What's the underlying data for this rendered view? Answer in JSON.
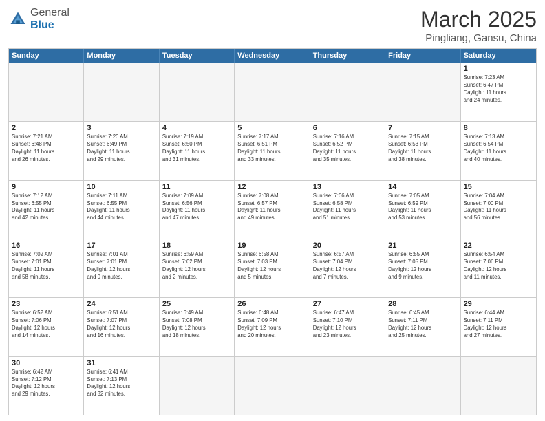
{
  "header": {
    "logo_general": "General",
    "logo_blue": "Blue",
    "month_year": "March 2025",
    "location": "Pingliang, Gansu, China"
  },
  "weekdays": [
    "Sunday",
    "Monday",
    "Tuesday",
    "Wednesday",
    "Thursday",
    "Friday",
    "Saturday"
  ],
  "rows": [
    [
      {
        "day": "",
        "info": ""
      },
      {
        "day": "",
        "info": ""
      },
      {
        "day": "",
        "info": ""
      },
      {
        "day": "",
        "info": ""
      },
      {
        "day": "",
        "info": ""
      },
      {
        "day": "",
        "info": ""
      },
      {
        "day": "1",
        "info": "Sunrise: 7:23 AM\nSunset: 6:47 PM\nDaylight: 11 hours\nand 24 minutes."
      }
    ],
    [
      {
        "day": "2",
        "info": "Sunrise: 7:21 AM\nSunset: 6:48 PM\nDaylight: 11 hours\nand 26 minutes."
      },
      {
        "day": "3",
        "info": "Sunrise: 7:20 AM\nSunset: 6:49 PM\nDaylight: 11 hours\nand 29 minutes."
      },
      {
        "day": "4",
        "info": "Sunrise: 7:19 AM\nSunset: 6:50 PM\nDaylight: 11 hours\nand 31 minutes."
      },
      {
        "day": "5",
        "info": "Sunrise: 7:17 AM\nSunset: 6:51 PM\nDaylight: 11 hours\nand 33 minutes."
      },
      {
        "day": "6",
        "info": "Sunrise: 7:16 AM\nSunset: 6:52 PM\nDaylight: 11 hours\nand 35 minutes."
      },
      {
        "day": "7",
        "info": "Sunrise: 7:15 AM\nSunset: 6:53 PM\nDaylight: 11 hours\nand 38 minutes."
      },
      {
        "day": "8",
        "info": "Sunrise: 7:13 AM\nSunset: 6:54 PM\nDaylight: 11 hours\nand 40 minutes."
      }
    ],
    [
      {
        "day": "9",
        "info": "Sunrise: 7:12 AM\nSunset: 6:55 PM\nDaylight: 11 hours\nand 42 minutes."
      },
      {
        "day": "10",
        "info": "Sunrise: 7:11 AM\nSunset: 6:55 PM\nDaylight: 11 hours\nand 44 minutes."
      },
      {
        "day": "11",
        "info": "Sunrise: 7:09 AM\nSunset: 6:56 PM\nDaylight: 11 hours\nand 47 minutes."
      },
      {
        "day": "12",
        "info": "Sunrise: 7:08 AM\nSunset: 6:57 PM\nDaylight: 11 hours\nand 49 minutes."
      },
      {
        "day": "13",
        "info": "Sunrise: 7:06 AM\nSunset: 6:58 PM\nDaylight: 11 hours\nand 51 minutes."
      },
      {
        "day": "14",
        "info": "Sunrise: 7:05 AM\nSunset: 6:59 PM\nDaylight: 11 hours\nand 53 minutes."
      },
      {
        "day": "15",
        "info": "Sunrise: 7:04 AM\nSunset: 7:00 PM\nDaylight: 11 hours\nand 56 minutes."
      }
    ],
    [
      {
        "day": "16",
        "info": "Sunrise: 7:02 AM\nSunset: 7:01 PM\nDaylight: 11 hours\nand 58 minutes."
      },
      {
        "day": "17",
        "info": "Sunrise: 7:01 AM\nSunset: 7:01 PM\nDaylight: 12 hours\nand 0 minutes."
      },
      {
        "day": "18",
        "info": "Sunrise: 6:59 AM\nSunset: 7:02 PM\nDaylight: 12 hours\nand 2 minutes."
      },
      {
        "day": "19",
        "info": "Sunrise: 6:58 AM\nSunset: 7:03 PM\nDaylight: 12 hours\nand 5 minutes."
      },
      {
        "day": "20",
        "info": "Sunrise: 6:57 AM\nSunset: 7:04 PM\nDaylight: 12 hours\nand 7 minutes."
      },
      {
        "day": "21",
        "info": "Sunrise: 6:55 AM\nSunset: 7:05 PM\nDaylight: 12 hours\nand 9 minutes."
      },
      {
        "day": "22",
        "info": "Sunrise: 6:54 AM\nSunset: 7:06 PM\nDaylight: 12 hours\nand 11 minutes."
      }
    ],
    [
      {
        "day": "23",
        "info": "Sunrise: 6:52 AM\nSunset: 7:06 PM\nDaylight: 12 hours\nand 14 minutes."
      },
      {
        "day": "24",
        "info": "Sunrise: 6:51 AM\nSunset: 7:07 PM\nDaylight: 12 hours\nand 16 minutes."
      },
      {
        "day": "25",
        "info": "Sunrise: 6:49 AM\nSunset: 7:08 PM\nDaylight: 12 hours\nand 18 minutes."
      },
      {
        "day": "26",
        "info": "Sunrise: 6:48 AM\nSunset: 7:09 PM\nDaylight: 12 hours\nand 20 minutes."
      },
      {
        "day": "27",
        "info": "Sunrise: 6:47 AM\nSunset: 7:10 PM\nDaylight: 12 hours\nand 23 minutes."
      },
      {
        "day": "28",
        "info": "Sunrise: 6:45 AM\nSunset: 7:11 PM\nDaylight: 12 hours\nand 25 minutes."
      },
      {
        "day": "29",
        "info": "Sunrise: 6:44 AM\nSunset: 7:11 PM\nDaylight: 12 hours\nand 27 minutes."
      }
    ],
    [
      {
        "day": "30",
        "info": "Sunrise: 6:42 AM\nSunset: 7:12 PM\nDaylight: 12 hours\nand 29 minutes."
      },
      {
        "day": "31",
        "info": "Sunrise: 6:41 AM\nSunset: 7:13 PM\nDaylight: 12 hours\nand 32 minutes."
      },
      {
        "day": "",
        "info": ""
      },
      {
        "day": "",
        "info": ""
      },
      {
        "day": "",
        "info": ""
      },
      {
        "day": "",
        "info": ""
      },
      {
        "day": "",
        "info": ""
      }
    ]
  ]
}
